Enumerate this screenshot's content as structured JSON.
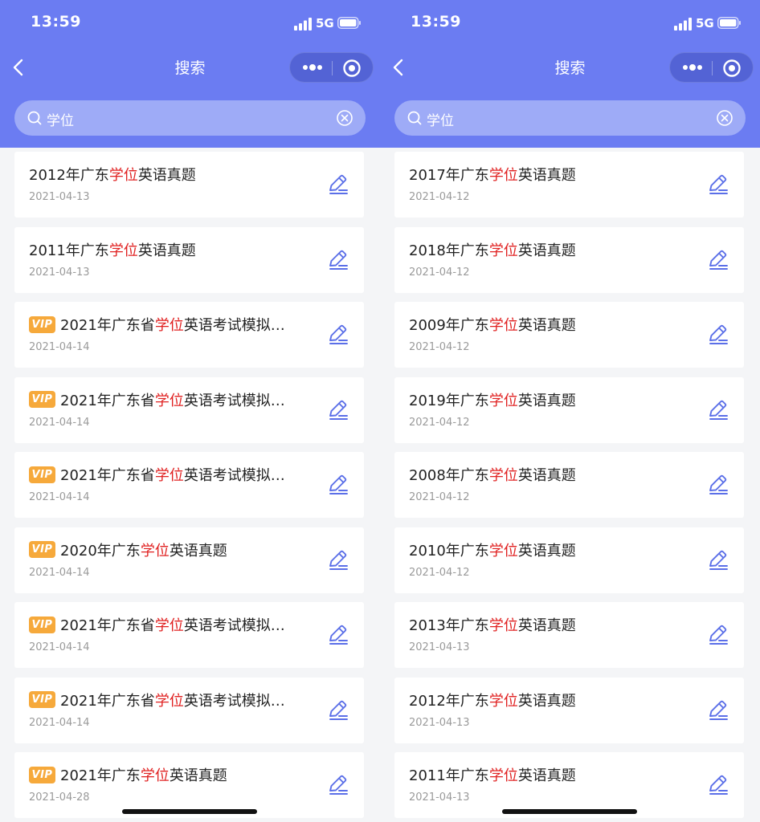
{
  "colors": {
    "accent": "#6b7cf2",
    "highlight": "#e02020",
    "vip": "#f6a93b"
  },
  "panels": [
    {
      "status": {
        "time": "13:59",
        "network": "5G"
      },
      "nav": {
        "title": "搜索"
      },
      "search": {
        "value": "学位"
      },
      "items": [
        {
          "vip": false,
          "pre": "2012年广东",
          "hl": "学位",
          "post": "英语真题",
          "date": "2021-04-13"
        },
        {
          "vip": false,
          "pre": "2011年广东",
          "hl": "学位",
          "post": "英语真题",
          "date": "2021-04-13"
        },
        {
          "vip": true,
          "vip_label": "VIP",
          "pre": "2021年广东省",
          "hl": "学位",
          "post": "英语考试模拟…",
          "date": "2021-04-14"
        },
        {
          "vip": true,
          "vip_label": "VIP",
          "pre": "2021年广东省",
          "hl": "学位",
          "post": "英语考试模拟…",
          "date": "2021-04-14"
        },
        {
          "vip": true,
          "vip_label": "VIP",
          "pre": "2021年广东省",
          "hl": "学位",
          "post": "英语考试模拟…",
          "date": "2021-04-14"
        },
        {
          "vip": true,
          "vip_label": "VIP",
          "pre": "2020年广东",
          "hl": "学位",
          "post": "英语真题",
          "date": "2021-04-14"
        },
        {
          "vip": true,
          "vip_label": "VIP",
          "pre": "2021年广东省",
          "hl": "学位",
          "post": "英语考试模拟…",
          "date": "2021-04-14"
        },
        {
          "vip": true,
          "vip_label": "VIP",
          "pre": "2021年广东省",
          "hl": "学位",
          "post": "英语考试模拟…",
          "date": "2021-04-14"
        },
        {
          "vip": true,
          "vip_label": "VIP",
          "pre": "2021年广东",
          "hl": "学位",
          "post": "英语真题",
          "date": "2021-04-28"
        }
      ]
    },
    {
      "status": {
        "time": "13:59",
        "network": "5G"
      },
      "nav": {
        "title": "搜索"
      },
      "search": {
        "value": "学位"
      },
      "items": [
        {
          "vip": false,
          "pre": "2017年广东",
          "hl": "学位",
          "post": "英语真题",
          "date": "2021-04-12"
        },
        {
          "vip": false,
          "pre": "2018年广东",
          "hl": "学位",
          "post": "英语真题",
          "date": "2021-04-12"
        },
        {
          "vip": false,
          "pre": "2009年广东",
          "hl": "学位",
          "post": "英语真题",
          "date": "2021-04-12"
        },
        {
          "vip": false,
          "pre": "2019年广东",
          "hl": "学位",
          "post": "英语真题",
          "date": "2021-04-12"
        },
        {
          "vip": false,
          "pre": "2008年广东",
          "hl": "学位",
          "post": "英语真题",
          "date": "2021-04-12"
        },
        {
          "vip": false,
          "pre": "2010年广东",
          "hl": "学位",
          "post": "英语真题",
          "date": "2021-04-12"
        },
        {
          "vip": false,
          "pre": "2013年广东",
          "hl": "学位",
          "post": "英语真题",
          "date": "2021-04-13"
        },
        {
          "vip": false,
          "pre": "2012年广东",
          "hl": "学位",
          "post": "英语真题",
          "date": "2021-04-13"
        },
        {
          "vip": false,
          "pre": "2011年广东",
          "hl": "学位",
          "post": "英语真题",
          "date": "2021-04-13"
        }
      ]
    }
  ]
}
